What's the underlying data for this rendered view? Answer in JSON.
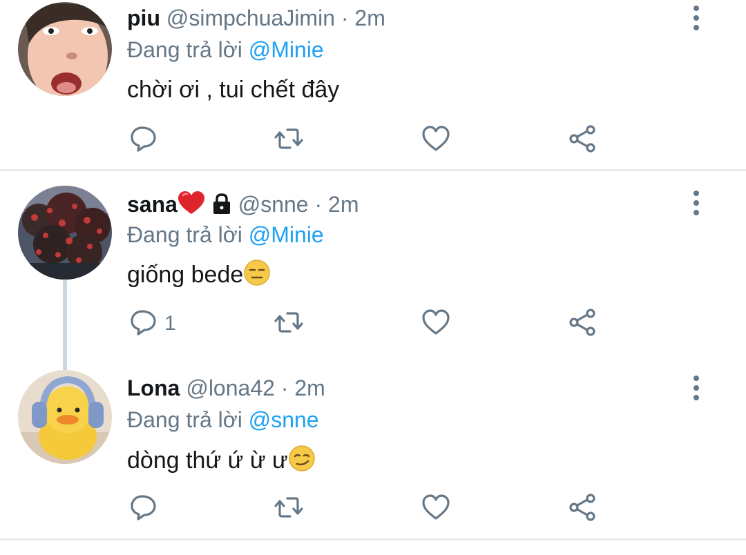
{
  "colors": {
    "accent": "#1da1f2",
    "secondary_text": "#657786",
    "icon": "#657786",
    "divider": "#e6ecf0",
    "thread_line": "#ccd6dd"
  },
  "reply_prefix": "Đang trả lời",
  "tweets": [
    {
      "name": "piu",
      "handle": "@simpchuaJimin",
      "separator": "·",
      "time": "2m",
      "replying_to": "@Minie",
      "text": "chời ơi , tui chết đây",
      "reply_count": ""
    },
    {
      "name": "sana",
      "name_emoji": "heart-icon",
      "protected_icon": "lock-icon",
      "handle": "@snne",
      "separator": "·",
      "time": "2m",
      "replying_to": "@Minie",
      "text": "giống bede",
      "text_emoji": "expressionless-face-emoji",
      "reply_count": "1"
    },
    {
      "name": "Lona",
      "handle": "@lona42",
      "separator": "·",
      "time": "2m",
      "replying_to": "@snne",
      "text": "dòng thứ ứ ừ ư",
      "text_emoji": "smirking-face-emoji",
      "reply_count": ""
    }
  ],
  "action_icons": [
    "reply-icon",
    "retweet-icon",
    "like-icon",
    "share-icon"
  ],
  "more_icon": "more-vertical-icon"
}
